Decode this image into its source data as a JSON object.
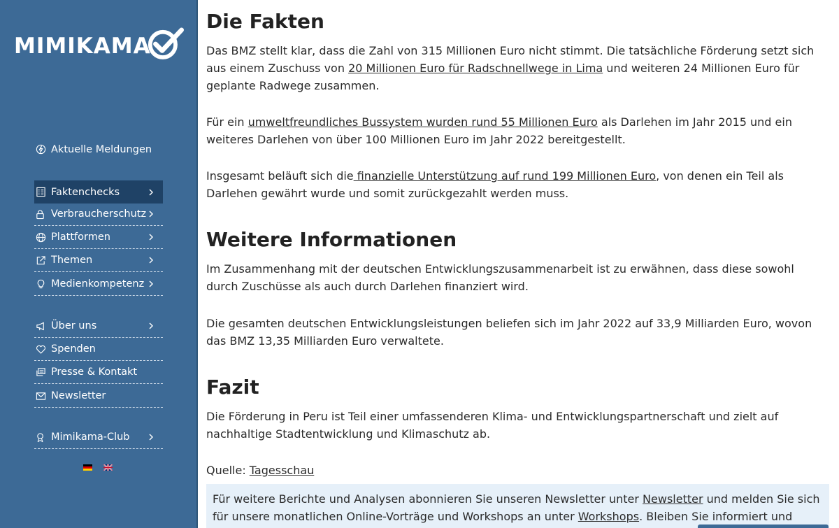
{
  "sidebar": {
    "logo_text": "MIMIKAMA",
    "items": [
      {
        "label": "Aktuelle Meldungen",
        "icon": "lightning-icon",
        "has_chevron": false
      },
      {
        "label": "Faktenchecks",
        "icon": "checklist-icon",
        "has_chevron": true,
        "active": true
      },
      {
        "label": "Verbraucherschutz",
        "icon": "lock-icon",
        "has_chevron": true
      },
      {
        "label": "Plattformen",
        "icon": "globe-icon",
        "has_chevron": true
      },
      {
        "label": "Themen",
        "icon": "external-link-icon",
        "has_chevron": true
      },
      {
        "label": "Medienkompetenz",
        "icon": "lightbulb-icon",
        "has_chevron": true
      },
      {
        "label": "Über uns",
        "icon": "megaphone-icon",
        "has_chevron": true
      },
      {
        "label": "Spenden",
        "icon": "heart-icon",
        "has_chevron": false
      },
      {
        "label": "Presse & Kontakt",
        "icon": "press-icon",
        "has_chevron": false
      },
      {
        "label": "Newsletter",
        "icon": "envelope-icon",
        "has_chevron": false
      },
      {
        "label": "Mimikama-Club",
        "icon": "club-icon",
        "has_chevron": true
      }
    ],
    "languages": [
      "de-flag-icon",
      "uk-flag-icon"
    ]
  },
  "article": {
    "h_fakten": "Die Fakten",
    "p1_a": "Das BMZ stellt klar, dass die Zahl von 315 Millionen Euro nicht stimmt. Die tatsächliche Förderung setzt sich aus einem Zuschuss von ",
    "p1_link": "20 Millionen Euro für Radschnellwege in Lima",
    "p1_b": " und weiteren 24 Millionen Euro für geplante Radwege zusammen.",
    "p2_a": "Für ein ",
    "p2_link": "umweltfreundliches Bussystem wurden rund 55 Millionen Euro",
    "p2_b": " als Darlehen im Jahr 2015 und ein weiteres Darlehen von über 100 Millionen Euro im Jahr 2022 bereitgestellt.",
    "p3_a": "Insgesamt beläuft sich die",
    "p3_link": " finanzielle Unterstützung auf rund 199 Millionen Euro",
    "p3_b": ", von denen ein Teil als Darlehen gewährt wurde und somit zurückgezahlt werden muss.",
    "h_weitere": "Weitere Informationen",
    "p4": "Im Zusammenhang mit der deutschen Entwicklungszusammenarbeit ist zu erwähnen, dass diese sowohl durch Zuschüsse als auch durch Darlehen finanziert wird.",
    "p5": "Die gesamten deutschen Entwicklungsleistungen beliefen sich im Jahr 2022 auf 33,9 Milliarden Euro, wovon das BMZ 13,35 Milliarden Euro verwaltete.",
    "h_fazit": "Fazit",
    "p6": "Die Förderung in Peru ist Teil einer umfassenderen Klima- und Entwicklungspartnerschaft und zielt auf nachhaltige Stadtentwicklung und Klimaschutz ab.",
    "source_label": "Quelle: ",
    "source_link": "Tagesschau"
  },
  "newsletter_box": {
    "text_a": "Für weitere Berichte und Analysen abonnieren Sie unseren Newsletter unter ",
    "link1": "Newsletter",
    "text_b": " und melden Sie sich für unsere monatlichen Online-Vorträge und Workshops an unter ",
    "link2": "Workshops",
    "text_c": ". Bleiben Sie informiert und kritisch!"
  },
  "colors": {
    "sidebar_bg": "#3d6a96",
    "active_item_bg": "#1f4266",
    "info_box_bg": "#e6f0f9"
  }
}
